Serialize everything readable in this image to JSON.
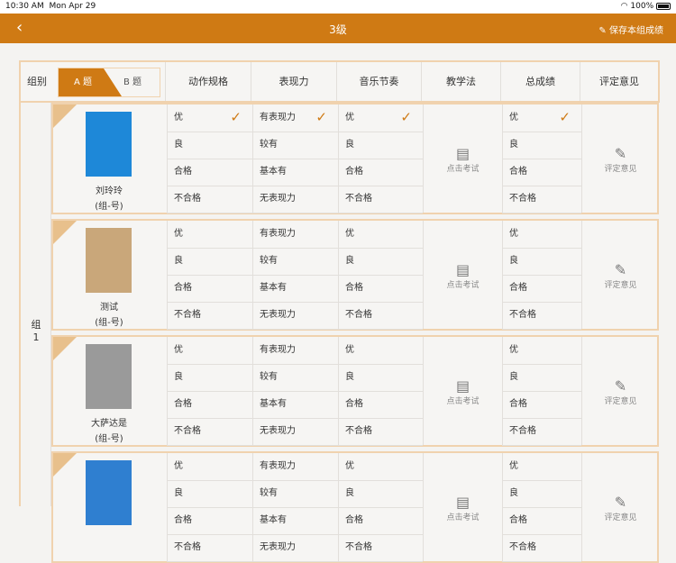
{
  "status": {
    "time": "10:30 AM",
    "date": "Mon Apr 29",
    "battery": "100%"
  },
  "nav": {
    "back": "‹",
    "title": "3级",
    "save": "保存本组成绩"
  },
  "header": {
    "group": "组别",
    "tab_a": "A 题",
    "tab_b": "B 题",
    "cols": [
      "动作规格",
      "表现力",
      "音乐节奏",
      "教学法",
      "总成绩",
      "评定意见"
    ]
  },
  "group_label": "组1",
  "exam_label": "点击考试",
  "comment_label": "评定意见",
  "options": {
    "action": [
      "优",
      "良",
      "合格",
      "不合格"
    ],
    "expr": [
      "有表现力",
      "较有",
      "基本有",
      "无表现力"
    ],
    "music": [
      "优",
      "良",
      "合格",
      "不合格"
    ],
    "total": [
      "优",
      "良",
      "合格",
      "不合格"
    ]
  },
  "students": [
    {
      "name": "刘玲玲",
      "id": "(组-号)",
      "photo": "#1e88d8",
      "checked": {
        "action": 0,
        "expr": 0,
        "music": 0,
        "total": 0
      }
    },
    {
      "name": "测试",
      "id": "(组-号)",
      "photo": "#c9a77a",
      "checked": {}
    },
    {
      "name": "大萨达是",
      "id": "(组-号)",
      "photo": "#9a9a9a",
      "checked": {}
    },
    {
      "name": "",
      "id": "",
      "photo": "#2f7fd0",
      "checked": {}
    }
  ]
}
